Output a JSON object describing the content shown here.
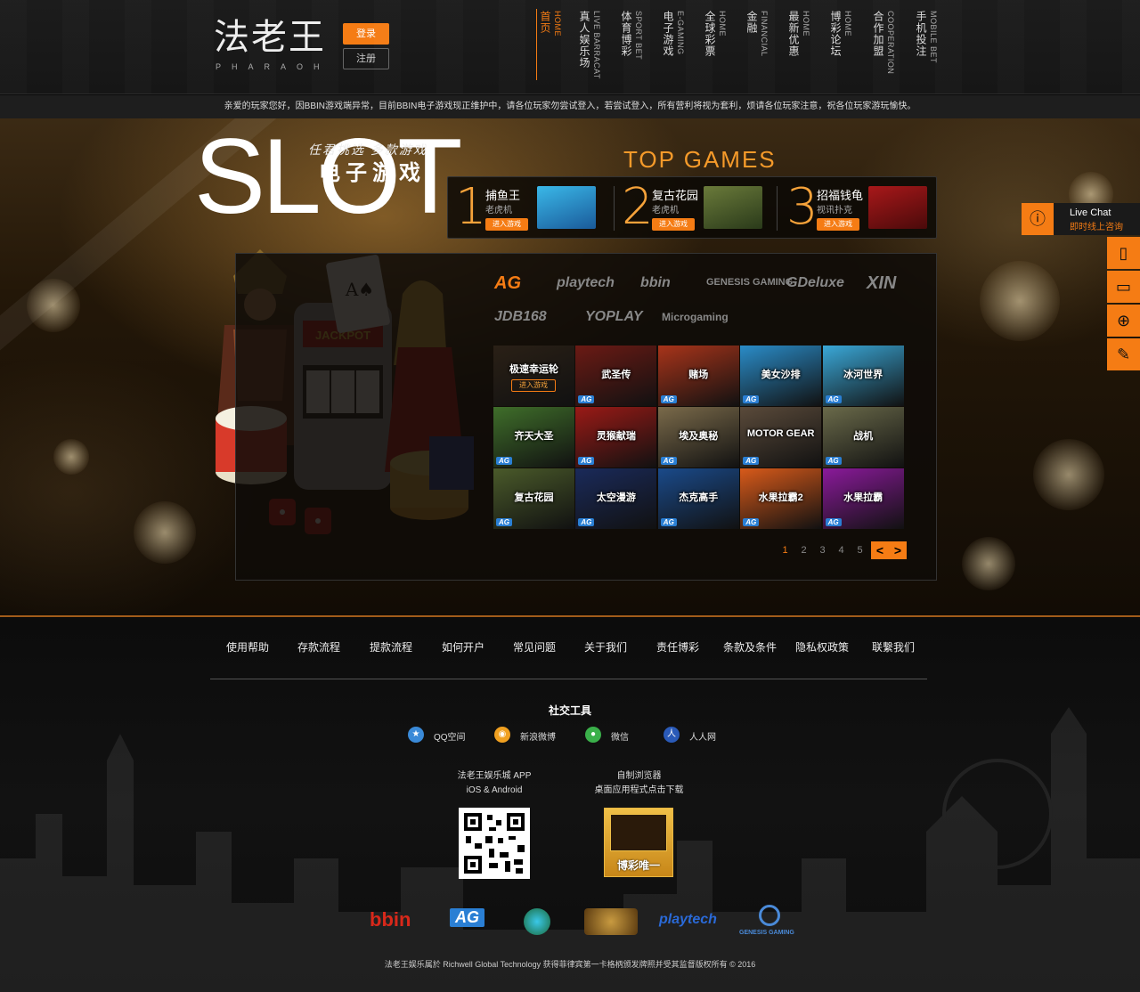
{
  "header": {
    "logo_text": "法老王",
    "logo_sub": "PHARAOH",
    "login_label": "登录",
    "register_label": "注册",
    "nav": [
      {
        "cn": "首页",
        "en": "HOME",
        "active": true
      },
      {
        "cn": "真人娱乐场",
        "en": "LIVE BARRACAT"
      },
      {
        "cn": "体育博彩",
        "en": "SPORT BET"
      },
      {
        "cn": "电子游戏",
        "en": "E-GAMING"
      },
      {
        "cn": "全球彩票",
        "en": "HOME"
      },
      {
        "cn": "金融",
        "en": "FINANCIAL"
      },
      {
        "cn": "最新优惠",
        "en": "HOME"
      },
      {
        "cn": "博彩论坛",
        "en": "HOME"
      },
      {
        "cn": "合作加盟",
        "en": "COOPERATION"
      },
      {
        "cn": "手机投注",
        "en": "MOBILE BET"
      }
    ]
  },
  "notice": "亲爱的玩家您好，因BBIN游戏端异常，目前BBIN电子游戏现正维护中，请各位玩家勿尝试登入，若尝试登入，所有营利将视为套利，烦请各位玩家注意，祝各位玩家游玩愉快。",
  "hero": {
    "slot_word": "SLOT",
    "tagline": "任君挑选  多款游戏",
    "subtitle": "电子游戏",
    "top_games_title": "TOP GAMES",
    "top_games": [
      {
        "rank": "1",
        "name": "捕鱼王",
        "type": "老虎机",
        "button": "进入游戏"
      },
      {
        "rank": "2",
        "name": "复古花园",
        "type": "老虎机",
        "button": "进入游戏"
      },
      {
        "rank": "3",
        "name": "招福钱龟",
        "type": "视讯扑克",
        "button": "进入游戏"
      }
    ],
    "providers": [
      "AG",
      "playtech",
      "bbin",
      "GENESIS GAMING",
      "GDeluxe",
      "XIN",
      "JDB168",
      "YOPLAY",
      "Microgaming"
    ],
    "games": [
      {
        "label": "极速幸运轮",
        "enter": "进入游戏",
        "badge": "",
        "color": "#2a2016"
      },
      {
        "label": "武圣传",
        "badge": "AG",
        "color": "#6b1a14"
      },
      {
        "label": "赌场",
        "badge": "AG",
        "color": "#a8341a"
      },
      {
        "label": "美女沙排",
        "badge": "AG",
        "color": "#2a8cc8"
      },
      {
        "label": "冰河世界",
        "badge": "AG",
        "color": "#3aa8d8"
      },
      {
        "label": "齐天大圣",
        "badge": "AG",
        "color": "#3f6e2a"
      },
      {
        "label": "灵猴献瑞",
        "badge": "AG",
        "color": "#9a1a16"
      },
      {
        "label": "埃及奥秘",
        "badge": "AG",
        "color": "#7a6a4a"
      },
      {
        "label": "MOTOR GEAR",
        "badge": "AG",
        "color": "#5a4a3a"
      },
      {
        "label": "战机",
        "badge": "AG",
        "color": "#6a6a4a"
      },
      {
        "label": "复古花园",
        "badge": "AG",
        "color": "#4a5a2a"
      },
      {
        "label": "太空漫游",
        "badge": "AG",
        "color": "#1a2a5a"
      },
      {
        "label": "杰克高手",
        "badge": "AG",
        "color": "#1a4a8a"
      },
      {
        "label": "水果拉霸2",
        "badge": "AG",
        "color": "#d85a1a"
      },
      {
        "label": "水果拉霸",
        "badge": "AG",
        "color": "#8a1a9a"
      }
    ],
    "pages": [
      "1",
      "2",
      "3",
      "4",
      "5"
    ],
    "prev": "<",
    "next": ">"
  },
  "dock": {
    "live_chat_en": "Live Chat",
    "live_chat_cn": "即时线上咨询"
  },
  "footer": {
    "links": [
      "使用帮助",
      "存款流程",
      "提款流程",
      "如何开户",
      "常见问题",
      "关于我们",
      "责任博彩",
      "条款及条件",
      "隐私权政策",
      "联繫我们"
    ],
    "social_title": "社交工具",
    "social": [
      {
        "label": "QQ空间",
        "color": "#3a8ad8"
      },
      {
        "label": "新浪微博",
        "color": "#f0a020"
      },
      {
        "label": "微信",
        "color": "#3ab04a"
      },
      {
        "label": "人人网",
        "color": "#2a5ab8"
      }
    ],
    "app_line1": "法老王娱乐城 APP",
    "app_line2": "iOS & Android",
    "browser_line1": "自制浏览器",
    "browser_line2": "桌面应用程式点击下载",
    "browser_banner": "博彩唯一",
    "partners": [
      "bbin",
      "AG",
      "playtech",
      "GENESIS GAMING"
    ],
    "copyright": "法老王娱乐属於 Richwell Global Technology 获得菲律宾第一卡格柄颁发牌照并受其监督版权所有 © 2016"
  }
}
